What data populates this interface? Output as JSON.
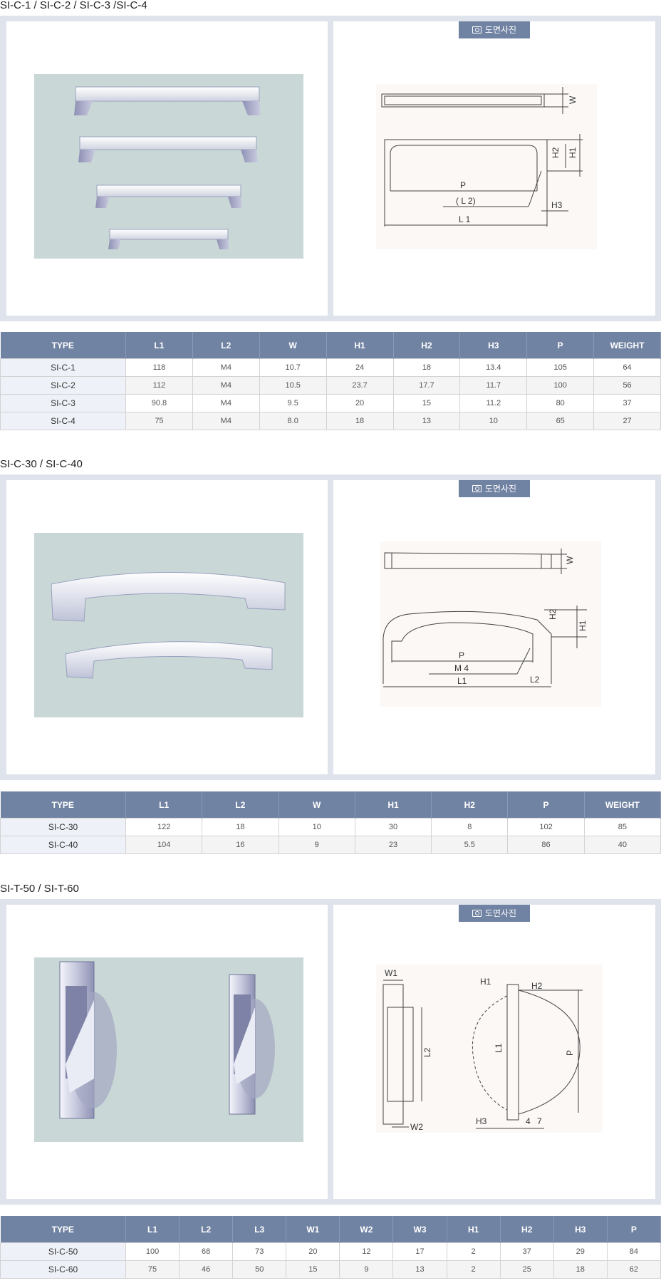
{
  "drawing_button_label": "도면사진",
  "sections": [
    {
      "title": "SI-C-1 / SI-C-2 / SI-C-3 /SI-C-4",
      "drawing_labels": {
        "w": "W",
        "h1": "H1",
        "h2": "H2",
        "p": "P",
        "l2": "( L 2)",
        "h3": "H3",
        "l1": "L 1"
      },
      "table": {
        "headers": [
          "TYPE",
          "L1",
          "L2",
          "W",
          "H1",
          "H2",
          "H3",
          "P",
          "WEIGHT"
        ],
        "rows": [
          [
            "SI-C-1",
            "118",
            "M4",
            "10.7",
            "24",
            "18",
            "13.4",
            "105",
            "64"
          ],
          [
            "SI-C-2",
            "112",
            "M4",
            "10.5",
            "23.7",
            "17.7",
            "11.7",
            "100",
            "56"
          ],
          [
            "SI-C-3",
            "90.8",
            "M4",
            "9.5",
            "20",
            "15",
            "11.2",
            "80",
            "37"
          ],
          [
            "SI-C-4",
            "75",
            "M4",
            "8.0",
            "18",
            "13",
            "10",
            "65",
            "27"
          ]
        ]
      }
    },
    {
      "title": "SI-C-30 / SI-C-40",
      "drawing_labels": {
        "w": "W",
        "h2": "H2",
        "h1": "H1",
        "p": "P",
        "m4": "M 4",
        "l1": "L1",
        "l2": "L2"
      },
      "table": {
        "headers": [
          "TYPE",
          "L1",
          "L2",
          "W",
          "H1",
          "H2",
          "P",
          "WEIGHT"
        ],
        "rows": [
          [
            "SI-C-30",
            "122",
            "18",
            "10",
            "30",
            "8",
            "102",
            "85"
          ],
          [
            "SI-C-40",
            "104",
            "16",
            "9",
            "23",
            "5.5",
            "86",
            "40"
          ]
        ]
      }
    },
    {
      "title": "SI-T-50 / SI-T-60",
      "drawing_labels": {
        "w1": "W1",
        "l2": "L2",
        "w2": "W2",
        "h1": "H1",
        "h2": "H2",
        "l1": "L1",
        "p": "P",
        "h3": "H3",
        "n4": "4",
        "n7": "7"
      },
      "table": {
        "headers": [
          "TYPE",
          "L1",
          "L2",
          "L3",
          "W1",
          "W2",
          "W3",
          "H1",
          "H2",
          "H3",
          "P"
        ],
        "rows": [
          [
            "SI-C-50",
            "100",
            "68",
            "73",
            "20",
            "12",
            "17",
            "2",
            "37",
            "29",
            "84"
          ],
          [
            "SI-C-60",
            "75",
            "46",
            "50",
            "15",
            "9",
            "13",
            "2",
            "25",
            "18",
            "62"
          ]
        ]
      }
    }
  ]
}
